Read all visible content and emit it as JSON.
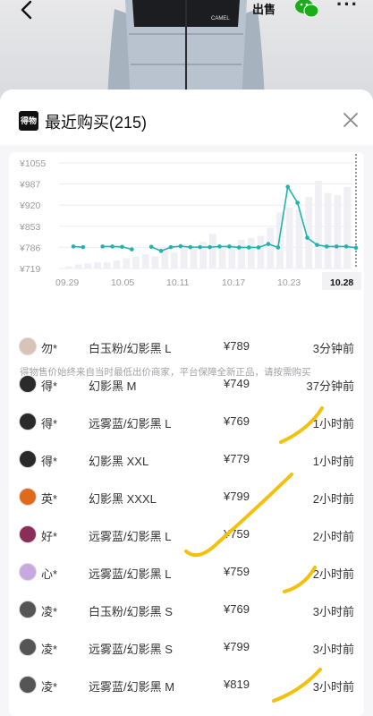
{
  "top_bar": {
    "back_icon": "chevron-left-icon",
    "sell_label": "出售",
    "wechat_icon": "wechat-icon",
    "more_label": "···"
  },
  "product": {
    "brand_label": "CAMEL"
  },
  "sheet": {
    "logo_text": "得物",
    "title": "最近购买(215)",
    "close_icon": "close-icon"
  },
  "chart_data": {
    "type": "line",
    "y_ticks": [
      "¥1055",
      "¥987",
      "¥920",
      "¥853",
      "¥786",
      "¥719"
    ],
    "x_ticks": [
      "09.29",
      "10.05",
      "10.11",
      "10.17",
      "10.23",
      "10.28"
    ],
    "highlight_tick": "10.28",
    "ylim": [
      719,
      1055
    ],
    "line_color": "#21b3ad",
    "bar_color": "#f0f0f4",
    "series": [
      {
        "values": [
          789,
          787,
          null,
          789,
          789,
          788,
          780,
          null,
          788,
          775,
          787,
          790,
          787,
          787,
          787,
          789,
          789,
          786,
          786,
          786,
          797,
          786,
          979,
          928,
          817,
          794,
          789,
          789,
          789,
          785
        ]
      }
    ],
    "bar_values": [
      2,
      4,
      5,
      6,
      6,
      8,
      10,
      12,
      14,
      12,
      18,
      16,
      24,
      20,
      26,
      34,
      20,
      24,
      28,
      30,
      32,
      40,
      55,
      60,
      58,
      70,
      86,
      74,
      72,
      80
    ]
  },
  "notice": "得物售价始终来自当时最低出价商家，平台保障全新正品，请按需购买",
  "purchases": [
    {
      "name": "勿*",
      "spec": "白玉粉/幻影黑 L",
      "price": "¥789",
      "time": "3分钟前",
      "avatar_color": "#d9c2b8"
    },
    {
      "name": "得*",
      "spec": "幻影黑 M",
      "price": "¥749",
      "time": "37分钟前",
      "avatar_color": "#2a2a2a"
    },
    {
      "name": "得*",
      "spec": "远雾蓝/幻影黑 L",
      "price": "¥769",
      "time": "1小时前",
      "avatar_color": "#2a2a2a"
    },
    {
      "name": "得*",
      "spec": "幻影黑 XXL",
      "price": "¥779",
      "time": "1小时前",
      "avatar_color": "#2a2a2a"
    },
    {
      "name": "英*",
      "spec": "幻影黑 XXXL",
      "price": "¥799",
      "time": "2小时前",
      "avatar_color": "#e06a1c"
    },
    {
      "name": "好*",
      "spec": "远雾蓝/幻影黑 L",
      "price": "¥759",
      "time": "2小时前",
      "avatar_color": "#8a2d58"
    },
    {
      "name": "心*",
      "spec": "远雾蓝/幻影黑 L",
      "price": "¥759",
      "time": "2小时前",
      "avatar_color": "#c8a8e0"
    },
    {
      "name": "凌*",
      "spec": "白玉粉/幻影黑 S",
      "price": "¥769",
      "time": "3小时前",
      "avatar_color": "#555555"
    },
    {
      "name": "凌*",
      "spec": "远雾蓝/幻影黑 S",
      "price": "¥799",
      "time": "3小时前",
      "avatar_color": "#555555"
    },
    {
      "name": "凌*",
      "spec": "远雾蓝/幻影黑 M",
      "price": "¥819",
      "time": "3小时前",
      "avatar_color": "#555555"
    }
  ],
  "scribble_color": "#f3c10c"
}
